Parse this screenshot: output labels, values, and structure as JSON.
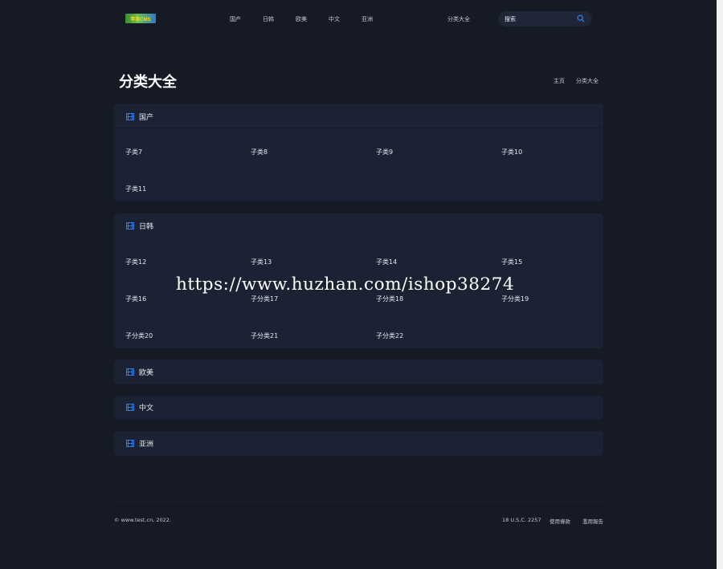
{
  "header": {
    "logo_text": "苹果CMS",
    "nav": [
      "国产",
      "日韩",
      "欧美",
      "中文",
      "亚洲"
    ],
    "all_categories": "分类大全",
    "search_placeholder": "搜索"
  },
  "page": {
    "title": "分类大全",
    "breadcrumb": [
      "主页",
      "分类大全"
    ]
  },
  "sections": [
    {
      "title": "国产",
      "items": [
        "子类7",
        "子类8",
        "子类9",
        "子类10",
        "子类11"
      ]
    },
    {
      "title": "日韩",
      "items": [
        "子类12",
        "子类13",
        "子类14",
        "子类15",
        "子类16",
        "子分类17",
        "子分类18",
        "子分类19",
        "子分类20",
        "子分类21",
        "子分类22"
      ]
    },
    {
      "title": "欧美",
      "items": []
    },
    {
      "title": "中文",
      "items": []
    },
    {
      "title": "亚洲",
      "items": []
    }
  ],
  "watermark": "https://www.huzhan.com/ishop38274",
  "footer": {
    "copyright": "© www.test.cn, 2022.",
    "links": [
      "18 U.S.C. 2257",
      "使用條款",
      "濫用報告"
    ]
  },
  "colors": {
    "background": "#151a24",
    "panel": "#1a2233",
    "accent": "#2f7de1"
  }
}
